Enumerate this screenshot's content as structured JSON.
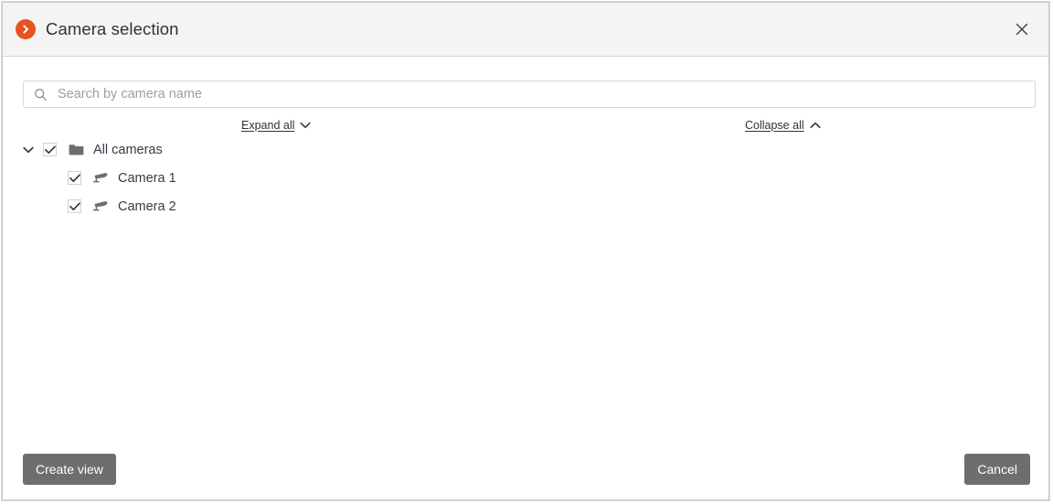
{
  "window": {
    "title": "Camera selection",
    "app_icon": "chevron-right-circle-icon",
    "accent_color": "#e8521f",
    "close_icon": "close-icon"
  },
  "search": {
    "placeholder": "Search by camera name",
    "value": "",
    "icon": "search-icon"
  },
  "tree_controls": {
    "expand_all": "Expand all",
    "expand_icon": "chevron-down-icon",
    "collapse_all": "Collapse all",
    "collapse_icon": "chevron-up-icon"
  },
  "tree": {
    "root": {
      "label": "All cameras",
      "icon": "folder-icon",
      "checked": true,
      "expanded": true,
      "twisty_icon": "chevron-down-icon"
    },
    "children": [
      {
        "label": "Camera 1",
        "icon": "camera-icon",
        "checked": true
      },
      {
        "label": "Camera 2",
        "icon": "camera-icon",
        "checked": true
      }
    ]
  },
  "footer": {
    "create_view": "Create view",
    "cancel": "Cancel",
    "button_color": "#6e6e6e"
  }
}
